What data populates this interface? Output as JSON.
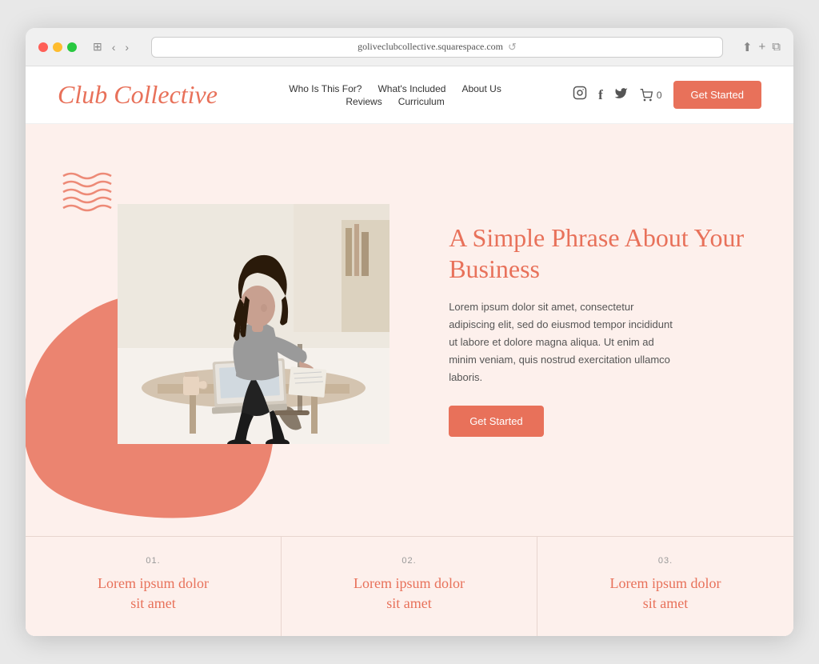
{
  "browser": {
    "url": "goliveclubcollective.squarespace.com",
    "refresh_icon": "↺"
  },
  "header": {
    "logo": "Club Collective",
    "nav": {
      "row1": [
        {
          "label": "Who Is This For?",
          "href": "#"
        },
        {
          "label": "What's Included",
          "href": "#"
        },
        {
          "label": "About Us",
          "href": "#"
        }
      ],
      "row2": [
        {
          "label": "Reviews",
          "href": "#"
        },
        {
          "label": "Curriculum",
          "href": "#"
        }
      ]
    },
    "cart_label": "0",
    "cta_label": "Get Started"
  },
  "hero": {
    "title": "A Simple Phrase About Your Business",
    "description": "Lorem ipsum dolor sit amet, consectetur adipiscing elit, sed do eiusmod tempor incididunt ut labore et dolore magna aliqua. Ut enim ad minim veniam, quis nostrud exercitation ullamco laboris.",
    "cta_label": "Get Started"
  },
  "features": [
    {
      "number": "01.",
      "title": "Lorem ipsum dolor sit amet"
    },
    {
      "number": "02.",
      "title": "Lorem ipsum dolor sit amet"
    },
    {
      "number": "03.",
      "title": "Lorem ipsum dolor sit amet"
    }
  ],
  "colors": {
    "brand": "#e8715a",
    "bg_light": "#fdf0ec",
    "text_dark": "#333333",
    "text_muted": "#555555"
  }
}
